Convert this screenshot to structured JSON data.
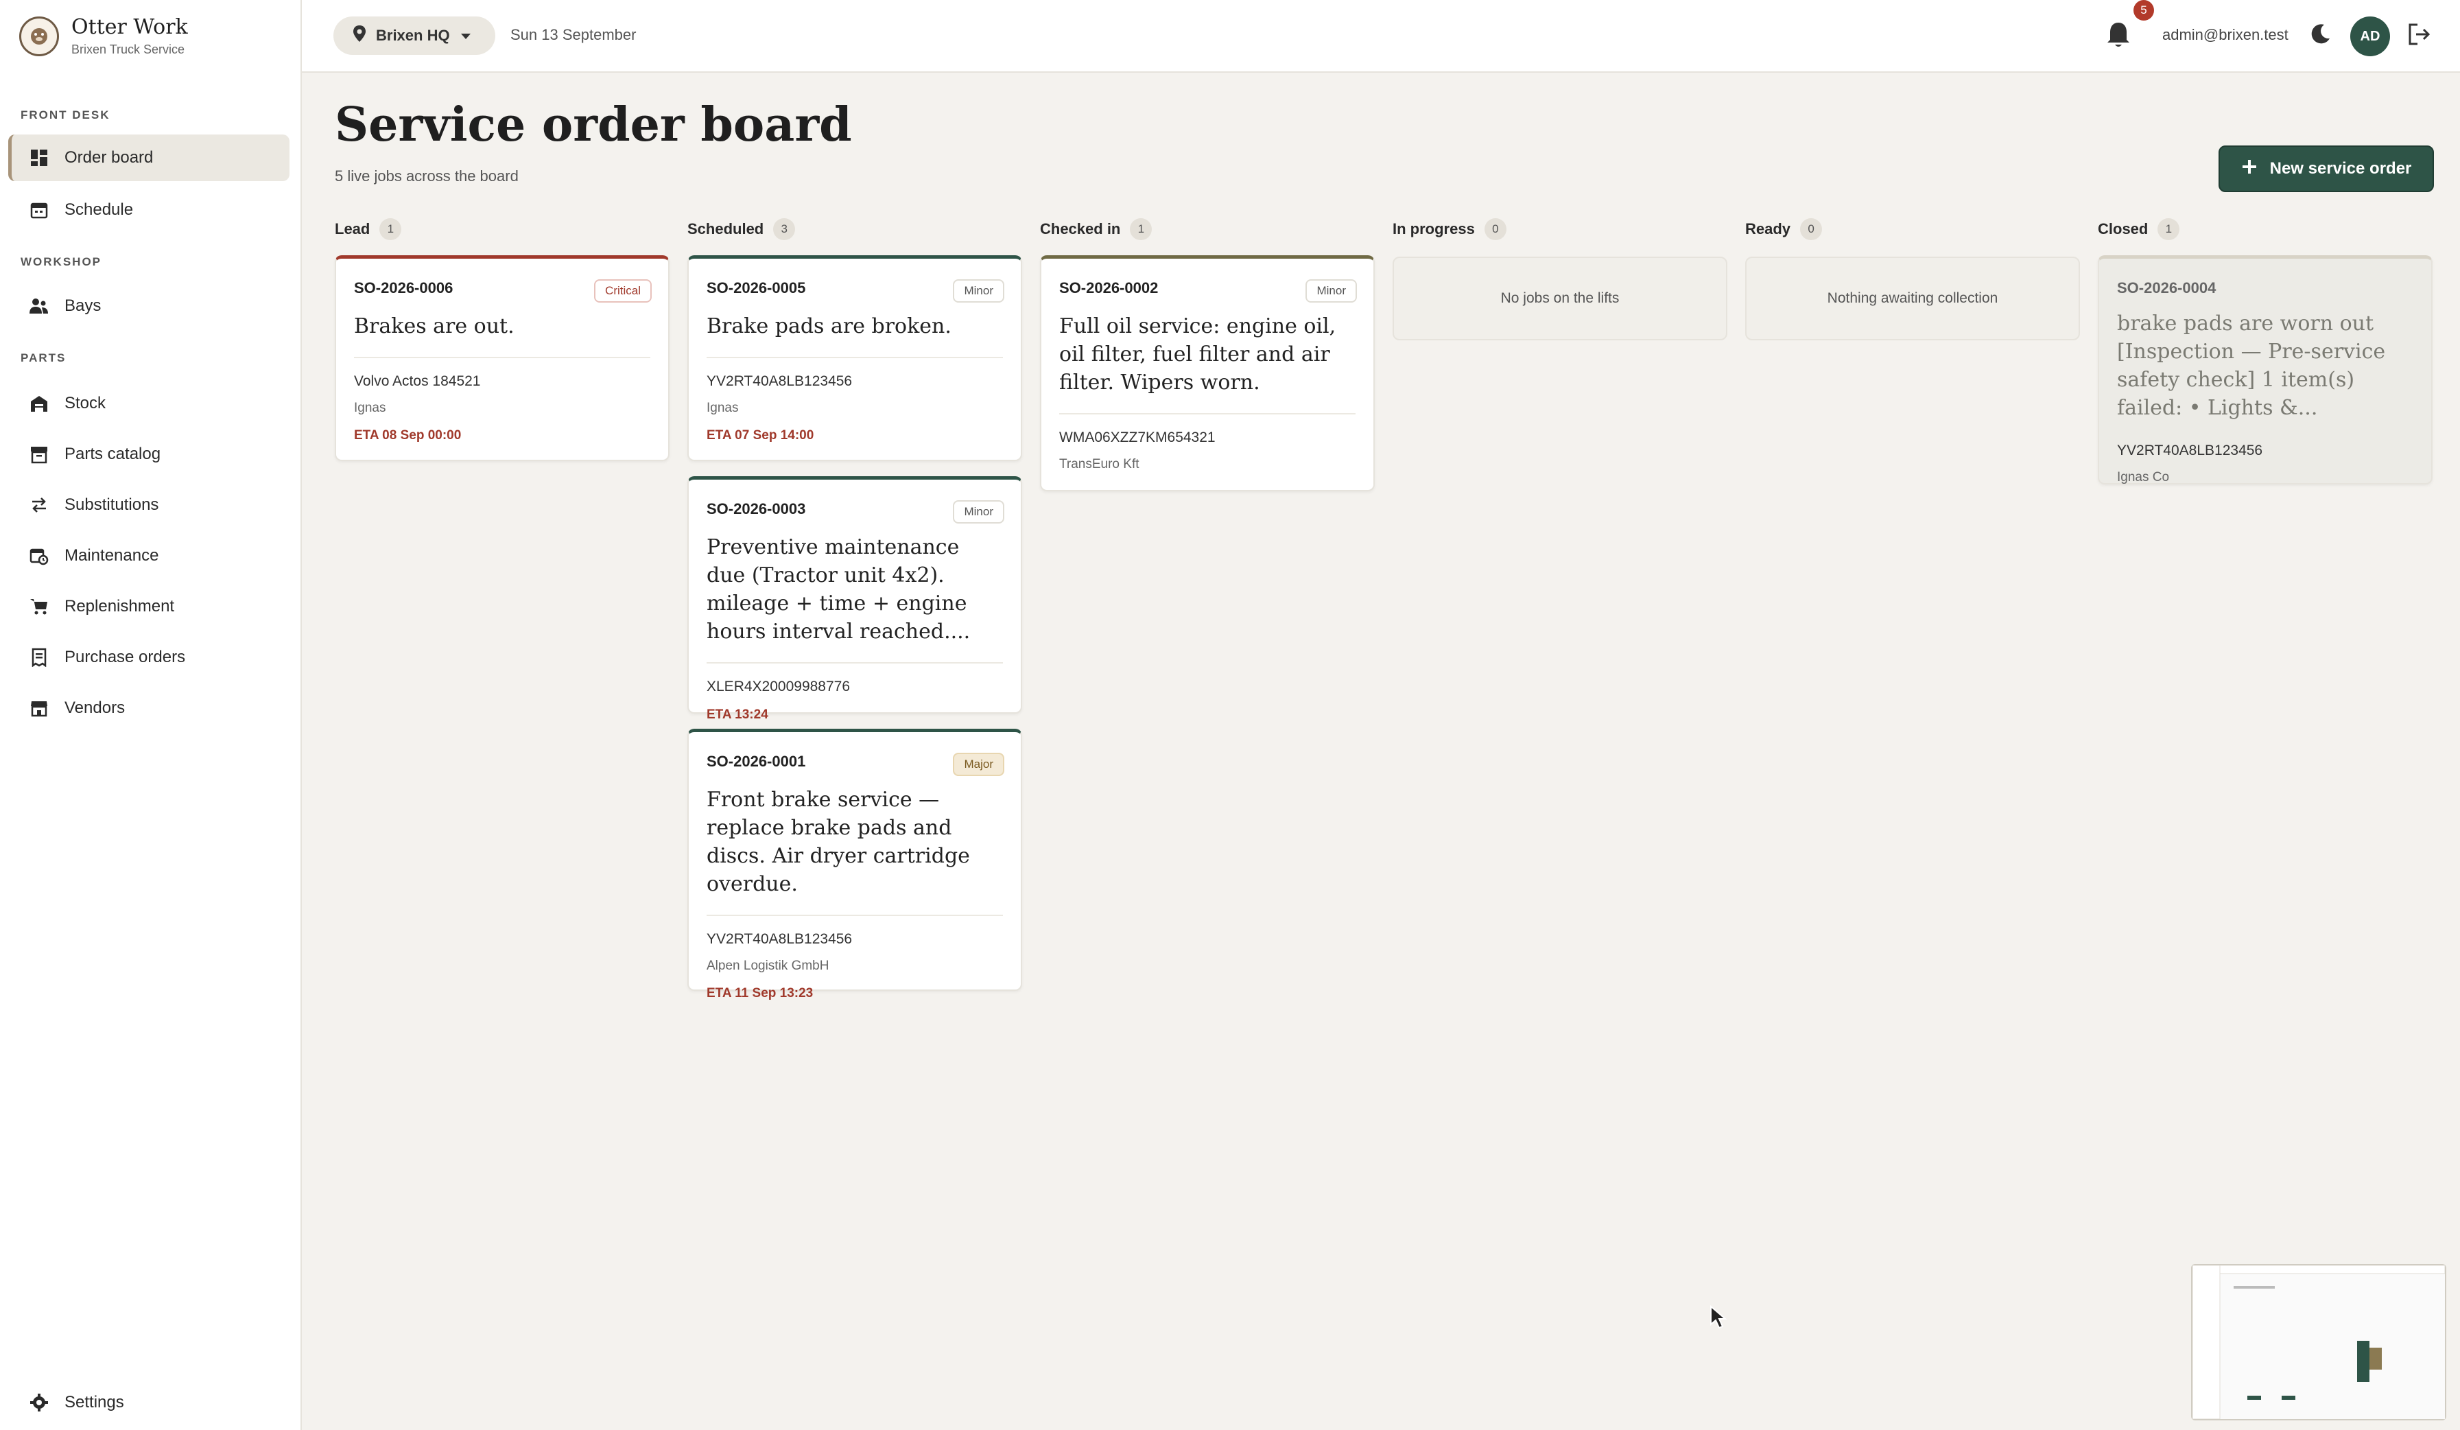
{
  "brand": {
    "name": "Otter Work",
    "subtitle": "Brixen Truck Service"
  },
  "sidebar": {
    "sections": {
      "front_desk": "FRONT DESK",
      "workshop": "WORKSHOP",
      "parts": "PARTS"
    },
    "items": {
      "order_board": "Order board",
      "schedule": "Schedule",
      "bays": "Bays",
      "stock": "Stock",
      "parts_catalog": "Parts catalog",
      "substitutions": "Substitutions",
      "maintenance": "Maintenance",
      "replenishment": "Replenishment",
      "purchase_orders": "Purchase orders",
      "vendors": "Vendors",
      "settings": "Settings"
    }
  },
  "topbar": {
    "location": "Brixen HQ",
    "date": "Sun 13 September",
    "notifications": "5",
    "user": "admin@brixen.test",
    "avatar": "AD"
  },
  "page": {
    "title": "Service order board",
    "subtitle": "5 live jobs across the board",
    "new_button": "New service order"
  },
  "columns": {
    "lead": {
      "name": "Lead",
      "count": "1"
    },
    "scheduled": {
      "name": "Scheduled",
      "count": "3"
    },
    "checked_in": {
      "name": "Checked in",
      "count": "1"
    },
    "in_progress": {
      "name": "In progress",
      "count": "0",
      "empty": "No jobs on the lifts"
    },
    "ready": {
      "name": "Ready",
      "count": "0",
      "empty": "Nothing awaiting collection"
    },
    "closed": {
      "name": "Closed",
      "count": "1"
    }
  },
  "cards": {
    "so6": {
      "id": "SO-2026-0006",
      "tag": "Critical",
      "title": "Brakes are out.",
      "vehicle": "Volvo Actos 184521",
      "customer": "Ignas",
      "eta": "ETA 08 Sep 00:00"
    },
    "so5": {
      "id": "SO-2026-0005",
      "tag": "Minor",
      "title": "Brake pads are broken.",
      "vehicle": "YV2RT40A8LB123456",
      "customer": "Ignas",
      "eta": "ETA 07 Sep 14:00"
    },
    "so3": {
      "id": "SO-2026-0003",
      "tag": "Minor",
      "title": "Preventive maintenance due (Tractor unit 4x2). mileage + time + engine hours interval reached....",
      "vehicle": "XLER4X20009988776",
      "eta": "ETA 13:24"
    },
    "so1": {
      "id": "SO-2026-0001",
      "tag": "Major",
      "title": "Front brake service — replace brake pads and discs. Air dryer cartridge overdue.",
      "vehicle": "YV2RT40A8LB123456",
      "customer": "Alpen Logistik GmbH",
      "eta": "ETA 11 Sep 13:23"
    },
    "so2": {
      "id": "SO-2026-0002",
      "tag": "Minor",
      "title": "Full oil service: engine oil, oil filter, fuel filter and air filter. Wipers worn.",
      "vehicle": "WMA06XZZ7KM654321",
      "customer": "TransEuro Kft"
    },
    "so4": {
      "id": "SO-2026-0004",
      "title": "brake pads are worn out [Inspection — Pre-service safety check] 1 item(s) failed: • Lights &...",
      "vehicle": "YV2RT40A8LB123456",
      "customer": "Ignas Co"
    }
  },
  "icons": {
    "brand": "otter-logo-icon",
    "location": "map-pin-icon",
    "bell": "bell-icon",
    "moon": "moon-icon",
    "logout": "logout-icon"
  },
  "colors": {
    "accent": "#2e5447",
    "critical": "#a0392b",
    "background": "#f4f2ee"
  }
}
